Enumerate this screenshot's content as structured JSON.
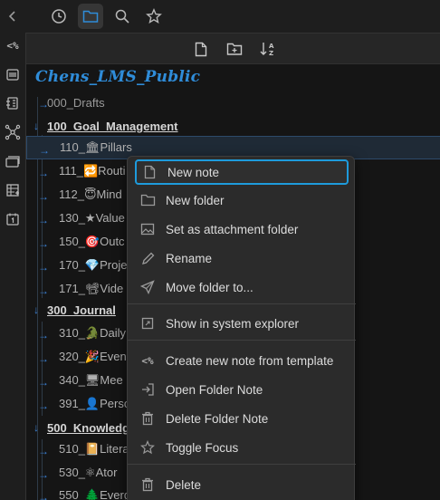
{
  "topbar": {
    "icons": [
      "chevron-left-icon",
      "clock-icon",
      "folder-icon",
      "search-icon",
      "star-icon"
    ]
  },
  "ribbon": {
    "template_text": "<%"
  },
  "vault": {
    "title": "Chens_LMS_Public"
  },
  "tree": {
    "drafts": "000_Drafts",
    "goal": "100_Goal_Management",
    "pillars": "110_🏛Pillars",
    "routines": "111_🔁Routi",
    "mind": "112_😇Mind",
    "values": "130_★Value",
    "outcomes": "150_🎯Outc",
    "projects": "170_💎Proje",
    "videos": "171_📽Vide",
    "journal": "300_Journal",
    "daily": "310_🐊Daily",
    "events": "320_🎉Even",
    "meetings": "340_🖥Mee",
    "personal": "391_👤Perso",
    "knowledge": "500_Knowledg",
    "literature": "510_📔Litera",
    "atomic": "530_⚛Ator",
    "evergreen": "550_🌲Everg"
  },
  "menu": {
    "new_note": "New note",
    "new_folder": "New folder",
    "set_attachment": "Set as attachment folder",
    "rename": "Rename",
    "move_folder": "Move folder to...",
    "show_explorer": "Show in system explorer",
    "template_icon_text": "<%",
    "create_from_template": "Create new note from template",
    "open_folder_note": "Open Folder Note",
    "delete_folder_note": "Delete Folder Note",
    "toggle_focus": "Toggle Focus",
    "delete": "Delete"
  },
  "colors": {
    "accent": "#1e9bdc",
    "vault_title": "#2f8cd8",
    "arrow": "#3b82d6"
  }
}
